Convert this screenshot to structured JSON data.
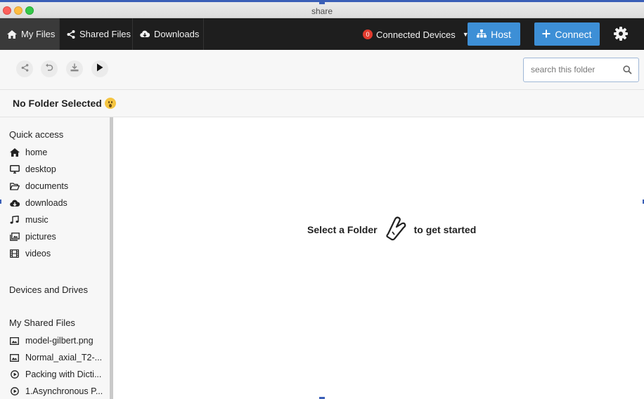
{
  "window": {
    "title": "share"
  },
  "nav": {
    "tabs": [
      {
        "label": "My Files",
        "icon": "home-icon",
        "active": true
      },
      {
        "label": "Shared Files",
        "icon": "share-icon",
        "active": false
      },
      {
        "label": "Downloads",
        "icon": "cloud-download-icon",
        "active": false
      }
    ],
    "connected_devices": {
      "count": "0",
      "label": "Connected Devices"
    },
    "host_label": "Host",
    "connect_label": "Connect",
    "settings_icon": "gear-icon"
  },
  "toolbar": {
    "actions": [
      "share-icon",
      "undo-icon",
      "download-icon",
      "play-icon"
    ],
    "search_placeholder": "search this folder"
  },
  "folder": {
    "title": "No Folder Selected",
    "emoji": "astonished-face"
  },
  "sidebar": {
    "quick_access_title": "Quick access",
    "quick_access": [
      {
        "label": "home",
        "icon": "home-icon"
      },
      {
        "label": "desktop",
        "icon": "desktop-icon"
      },
      {
        "label": "documents",
        "icon": "folder-open-icon"
      },
      {
        "label": "downloads",
        "icon": "cloud-download-icon"
      },
      {
        "label": "music",
        "icon": "music-icon"
      },
      {
        "label": "pictures",
        "icon": "pictures-icon"
      },
      {
        "label": "videos",
        "icon": "film-icon"
      }
    ],
    "devices_title": "Devices and Drives",
    "shared_title": "My Shared Files",
    "shared_files": [
      {
        "label": "model-gilbert.png",
        "icon": "image-icon"
      },
      {
        "label": "Normal_axial_T2-...",
        "icon": "image-icon"
      },
      {
        "label": "Packing with Dicti...",
        "icon": "play-circle-icon"
      },
      {
        "label": "1.Asynchronous P...",
        "icon": "play-circle-icon"
      }
    ]
  },
  "main": {
    "empty_prefix": "Select a Folder",
    "empty_suffix": "to get started",
    "empty_icon": "hand-pointer-icon"
  },
  "colors": {
    "nav_bg": "#1e1e1e",
    "button_blue": "#3d8fd6",
    "badge_red": "#e23b2e",
    "titlebar_accent": "#3a5fb7"
  }
}
